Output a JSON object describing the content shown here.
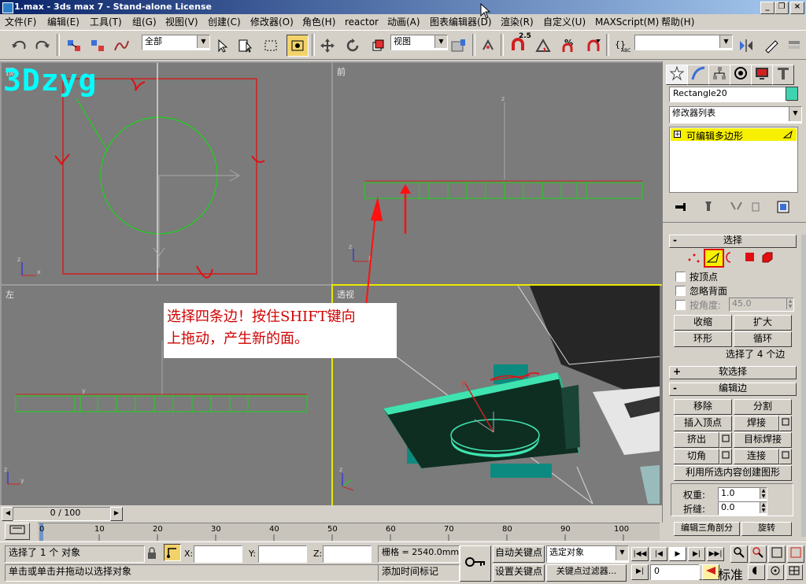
{
  "window": {
    "title": "1.max - 3ds max 7  - Stand-alone License",
    "btn_min": "_",
    "btn_restore": "❐",
    "btn_close": "×"
  },
  "menu": [
    "文件(F)",
    "编辑(E)",
    "工具(T)",
    "组(G)",
    "视图(V)",
    "创建(C)",
    "修改器(O)",
    "角色(H)",
    "reactor",
    "动画(A)",
    "图表编辑器(D)",
    "渲染(R)",
    "自定义(U)",
    "MAXScript(M)",
    "帮助(H)"
  ],
  "toolbar": {
    "selection_filter": "全部",
    "ref_coord": "视图",
    "snap_value": "2.5",
    "named_selection": ""
  },
  "watermark": "3Dzyg",
  "viewports": {
    "top": {
      "label": "顶"
    },
    "front": {
      "label": "前"
    },
    "left": {
      "label": "左"
    },
    "perspective": {
      "label": "透视"
    }
  },
  "callout": {
    "line1": "选择四条边！按住SHIFT键向",
    "line2": "上拖动，产生新的面。"
  },
  "command_panel": {
    "object_name": "Rectangle20",
    "object_color": "#3fd4b0",
    "modifier_list": "修改器列表",
    "stack_item": "可编辑多边形",
    "selection": {
      "header": "选择",
      "by_vertex": "按顶点",
      "ignore_backface": "忽略背面",
      "by_angle": "按角度:",
      "angle_value": "45.0",
      "shrink": "收缩",
      "grow": "扩大",
      "ring": "环形",
      "loop": "循环",
      "status": "选择了 4 个边"
    },
    "soft_selection": {
      "header": "软选择"
    },
    "edit_edges": {
      "header": "编辑边",
      "remove": "移除",
      "split": "分割",
      "insert_vertex": "插入顶点",
      "weld": "焊接",
      "extrude": "挤出",
      "target_weld": "目标焊接",
      "chamfer": "切角",
      "connect": "连接",
      "create_shape": "利用所选内容创建图形",
      "weight_label": "权重:",
      "weight_value": "1.0",
      "crease_label": "折缝:",
      "crease_value": "0.0",
      "edit_tri": "编辑三角剖分",
      "turn": "旋转"
    }
  },
  "timeline": {
    "frame_display": "0 / 100",
    "ticks": [
      "0",
      "10",
      "20",
      "30",
      "40",
      "50",
      "60",
      "70",
      "80",
      "90",
      "100"
    ]
  },
  "status": {
    "selected": "选择了 1 个 对象",
    "x_label": "X:",
    "y_label": "Y:",
    "z_label": "Z:",
    "grid": "栅格 = 2540.0mm",
    "prompt": "单击或单击并拖动以选择对象",
    "add_time_tag": "添加时间标记",
    "auto_key": "自动关键点",
    "set_key": "设置关键点",
    "key_mode": "选定对象",
    "key_filters": "关键点过滤器...",
    "current_frame": "0",
    "standard": "标准"
  }
}
